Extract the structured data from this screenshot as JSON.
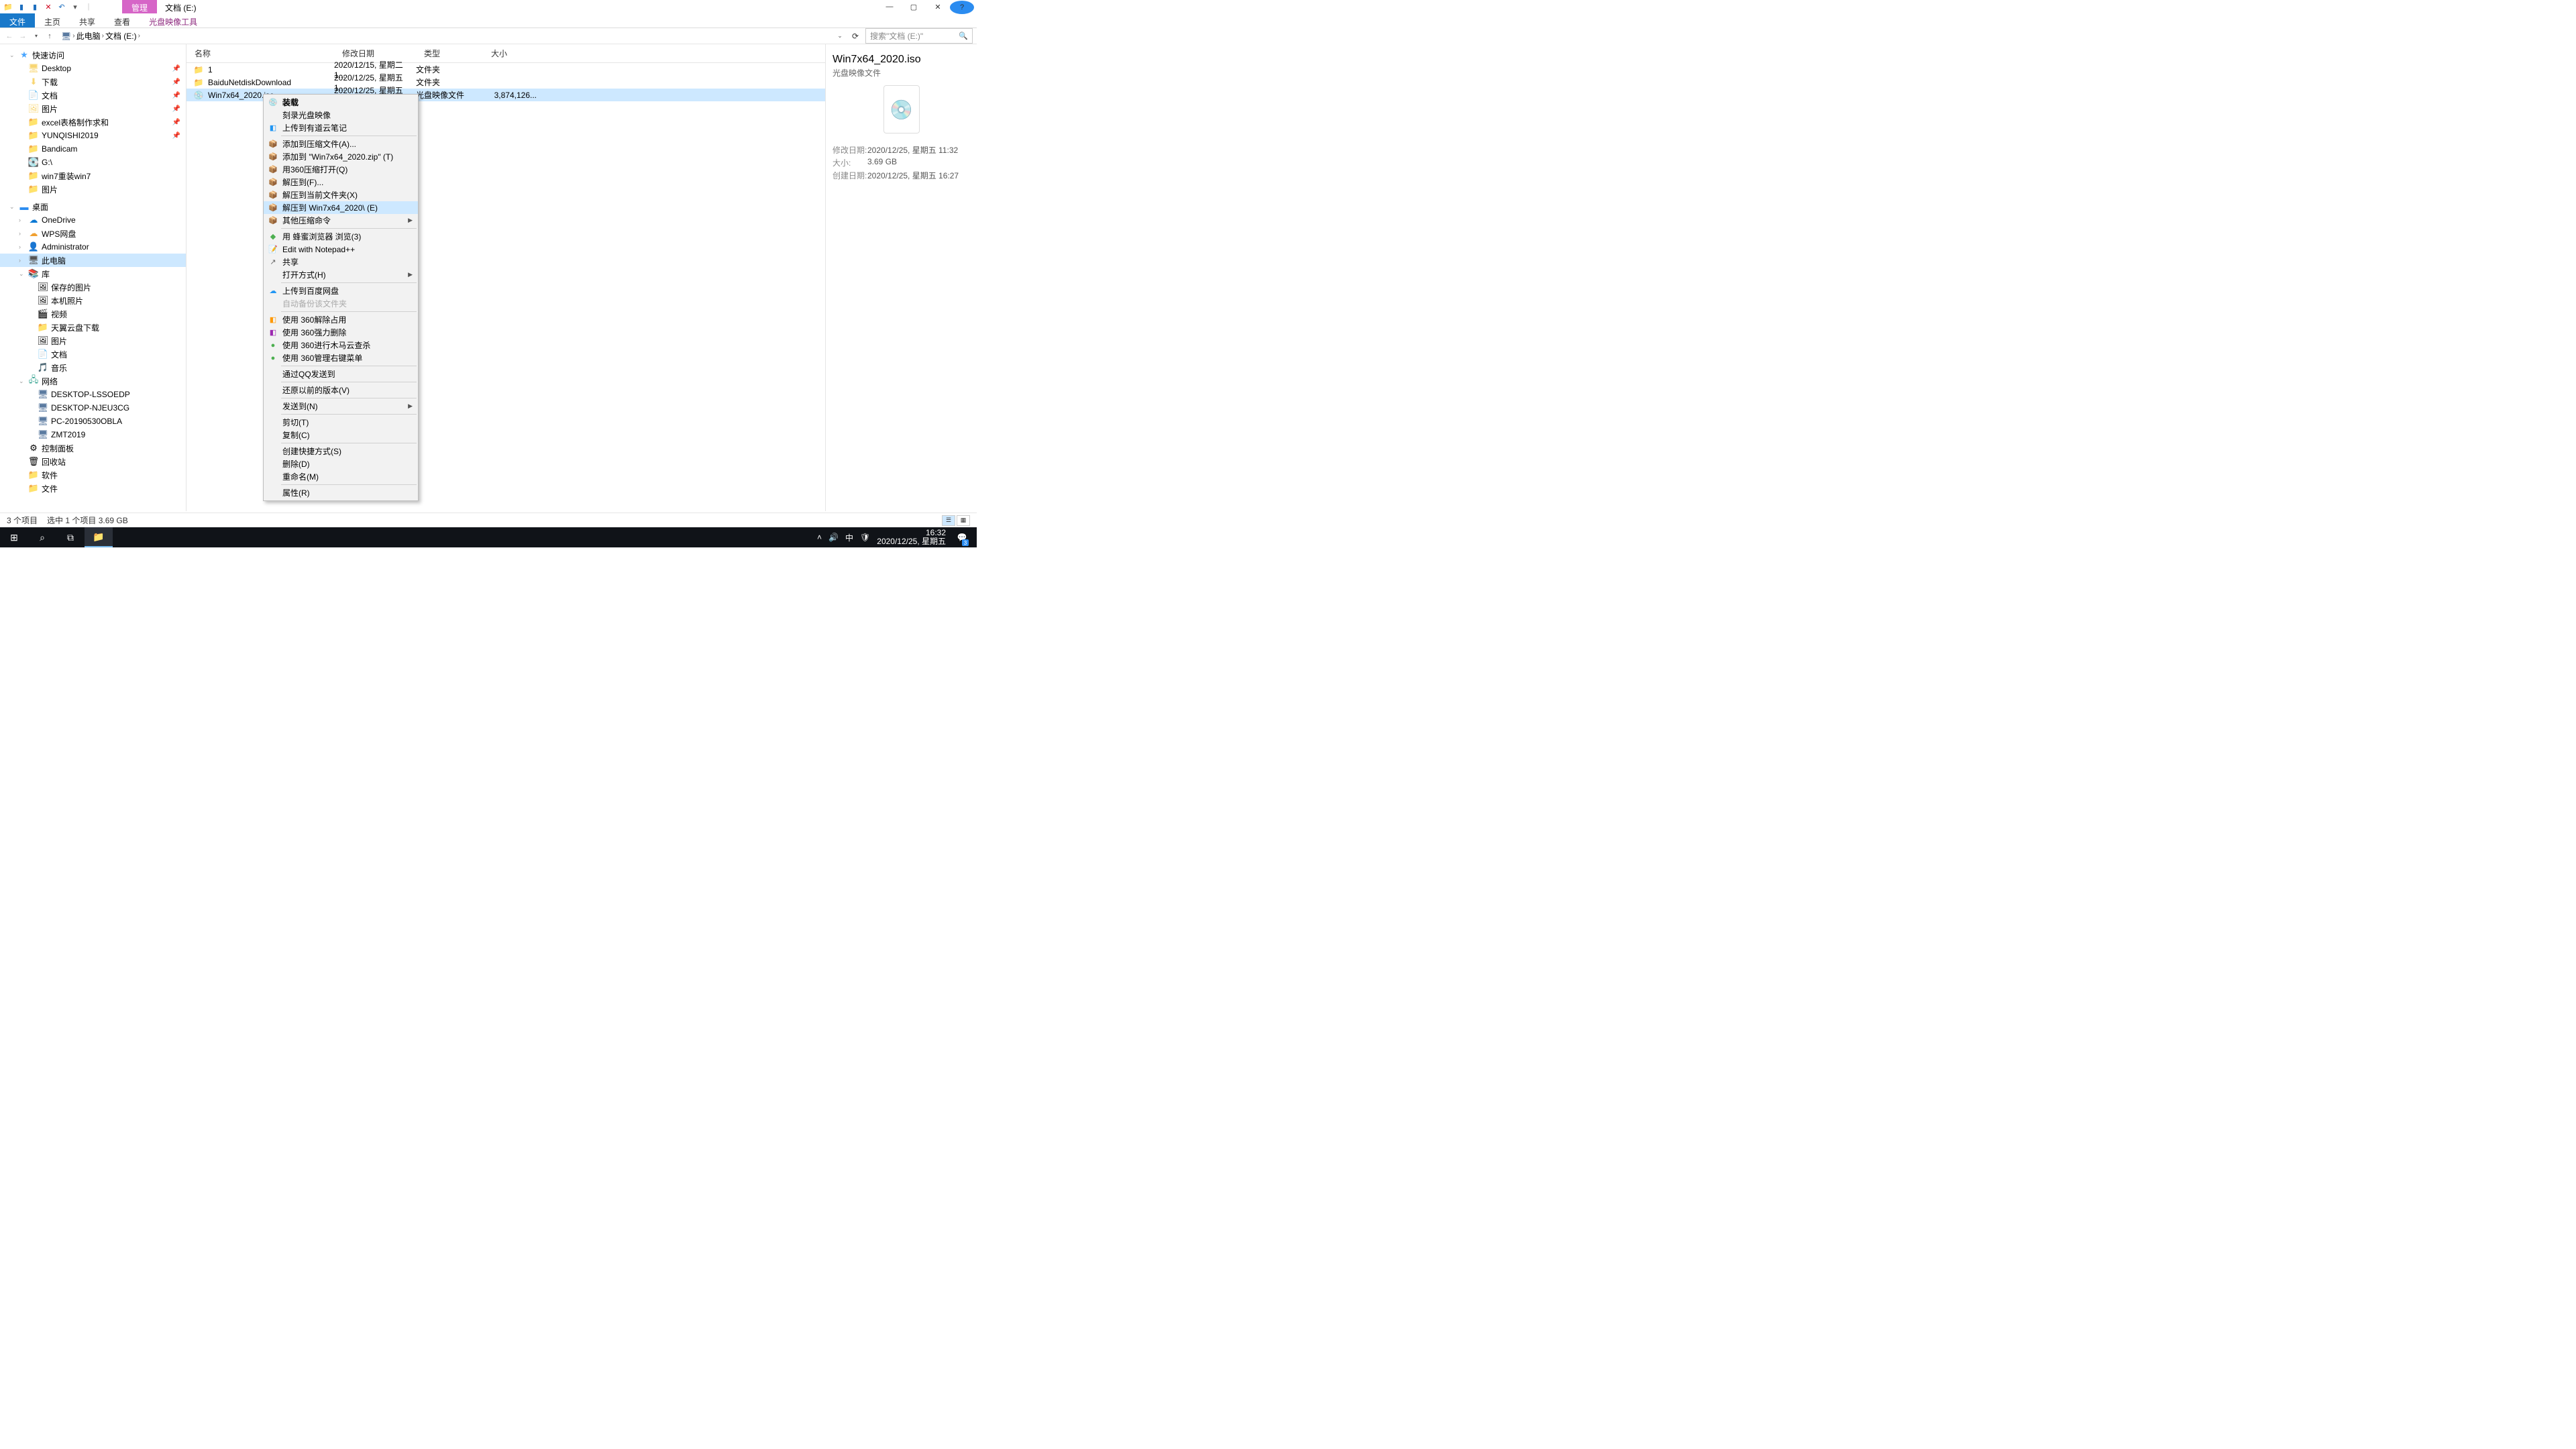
{
  "window": {
    "title": "文档 (E:)",
    "ctx_tab": "管理"
  },
  "ribbon": {
    "tabs": [
      "文件",
      "主页",
      "共享",
      "查看"
    ],
    "ctx": "光盘映像工具",
    "active": 0
  },
  "addr": {
    "crumbs": [
      "此电脑",
      "文档 (E:)"
    ],
    "dd": "›",
    "search_ph": "搜索\"文档 (E:)\""
  },
  "nav": {
    "quick": {
      "label": "快速访问",
      "items": [
        {
          "i": "🖥",
          "l": "Desktop",
          "p": true
        },
        {
          "i": "⬇",
          "l": "下载",
          "p": true
        },
        {
          "i": "📄",
          "l": "文档",
          "p": true
        },
        {
          "i": "🖼",
          "l": "图片",
          "p": true
        },
        {
          "i": "📁",
          "l": "excel表格制作求和",
          "p": true
        },
        {
          "i": "📁",
          "l": "YUNQISHI2019",
          "p": true
        },
        {
          "i": "📁",
          "l": "Bandicam"
        },
        {
          "i": "💽",
          "l": "G:\\"
        },
        {
          "i": "📁",
          "l": "win7重装win7"
        },
        {
          "i": "📁",
          "l": "图片"
        }
      ]
    },
    "desktop": {
      "label": "桌面",
      "items": [
        {
          "i": "☁",
          "l": "OneDrive",
          "c": "#0a78d4"
        },
        {
          "i": "☁",
          "l": "WPS网盘",
          "c": "#f0a030"
        },
        {
          "i": "👤",
          "l": "Administrator"
        },
        {
          "i": "🖥",
          "l": "此电脑",
          "sel": true
        },
        {
          "i": "📚",
          "l": "库",
          "exp": true
        }
      ]
    },
    "lib": [
      {
        "i": "🖼",
        "l": "保存的图片"
      },
      {
        "i": "🖼",
        "l": "本机照片"
      },
      {
        "i": "🎬",
        "l": "视频"
      },
      {
        "i": "📁",
        "l": "天翼云盘下载"
      },
      {
        "i": "🖼",
        "l": "图片"
      },
      {
        "i": "📄",
        "l": "文档"
      },
      {
        "i": "🎵",
        "l": "音乐"
      }
    ],
    "network": {
      "label": "网络",
      "items": [
        {
          "i": "🖥",
          "l": "DESKTOP-LSSOEDP"
        },
        {
          "i": "🖥",
          "l": "DESKTOP-NJEU3CG"
        },
        {
          "i": "🖥",
          "l": "PC-20190530OBLA"
        },
        {
          "i": "🖥",
          "l": "ZMT2019"
        }
      ]
    },
    "tail": [
      {
        "i": "⚙",
        "l": "控制面板"
      },
      {
        "i": "🗑",
        "l": "回收站"
      },
      {
        "i": "📁",
        "l": "软件"
      },
      {
        "i": "📁",
        "l": "文件"
      }
    ]
  },
  "cols": {
    "c1": "名称",
    "c2": "修改日期",
    "c3": "类型",
    "c4": "大小"
  },
  "rows": [
    {
      "i": "📁",
      "n": "1",
      "d": "2020/12/15, 星期二 1...",
      "t": "文件夹",
      "s": ""
    },
    {
      "i": "📁",
      "n": "BaiduNetdiskDownload",
      "d": "2020/12/25, 星期五 1...",
      "t": "文件夹",
      "s": ""
    },
    {
      "i": "💿",
      "n": "Win7x64_2020.iso",
      "d": "2020/12/25, 星期五 1...",
      "t": "光盘映像文件",
      "s": "3,874,126...",
      "sel": true
    }
  ],
  "ctx": [
    {
      "l": "装载",
      "i": "💿",
      "bold": true
    },
    {
      "l": "刻录光盘映像"
    },
    {
      "l": "上传到有道云笔记",
      "i": "◧",
      "c": "#2196f3"
    },
    {
      "sep": true
    },
    {
      "l": "添加到压缩文件(A)...",
      "i": "📦"
    },
    {
      "l": "添加到 \"Win7x64_2020.zip\" (T)",
      "i": "📦"
    },
    {
      "l": "用360压缩打开(Q)",
      "i": "📦"
    },
    {
      "l": "解压到(F)...",
      "i": "📦"
    },
    {
      "l": "解压到当前文件夹(X)",
      "i": "📦"
    },
    {
      "l": "解压到 Win7x64_2020\\ (E)",
      "i": "📦",
      "hov": true
    },
    {
      "l": "其他压缩命令",
      "i": "📦",
      "sub": true
    },
    {
      "sep": true
    },
    {
      "l": "用 蜂蜜浏览器 浏览(3)",
      "i": "◆",
      "c": "#4caf50"
    },
    {
      "l": "Edit with Notepad++",
      "i": "📝"
    },
    {
      "l": "共享",
      "i": "↗"
    },
    {
      "l": "打开方式(H)",
      "sub": true
    },
    {
      "sep": true
    },
    {
      "l": "上传到百度网盘",
      "i": "☁",
      "c": "#2196f3"
    },
    {
      "l": "自动备份该文件夹",
      "dis": true
    },
    {
      "sep": true
    },
    {
      "l": "使用 360解除占用",
      "i": "◧",
      "c": "#ff9800"
    },
    {
      "l": "使用 360强力删除",
      "i": "◧",
      "c": "#9c27b0"
    },
    {
      "l": "使用 360进行木马云查杀",
      "i": "●",
      "c": "#4caf50"
    },
    {
      "l": "使用 360管理右键菜单",
      "i": "●",
      "c": "#4caf50"
    },
    {
      "sep": true
    },
    {
      "l": "通过QQ发送到"
    },
    {
      "sep": true
    },
    {
      "l": "还原以前的版本(V)"
    },
    {
      "sep": true
    },
    {
      "l": "发送到(N)",
      "sub": true
    },
    {
      "sep": true
    },
    {
      "l": "剪切(T)"
    },
    {
      "l": "复制(C)"
    },
    {
      "sep": true
    },
    {
      "l": "创建快捷方式(S)"
    },
    {
      "l": "删除(D)"
    },
    {
      "l": "重命名(M)"
    },
    {
      "sep": true
    },
    {
      "l": "属性(R)"
    }
  ],
  "details": {
    "name": "Win7x64_2020.iso",
    "type": "光盘映像文件",
    "props": [
      {
        "k": "修改日期:",
        "v": "2020/12/25, 星期五 11:32"
      },
      {
        "k": "大小:",
        "v": "3.69 GB"
      },
      {
        "k": "创建日期:",
        "v": "2020/12/25, 星期五 16:27"
      }
    ]
  },
  "status": {
    "a": "3 个项目",
    "b": "选中 1 个项目  3.69 GB"
  },
  "taskbar": {
    "tray": {
      "ime": "中",
      "time": "16:32",
      "date": "2020/12/25, 星期五",
      "badge": "3"
    }
  }
}
